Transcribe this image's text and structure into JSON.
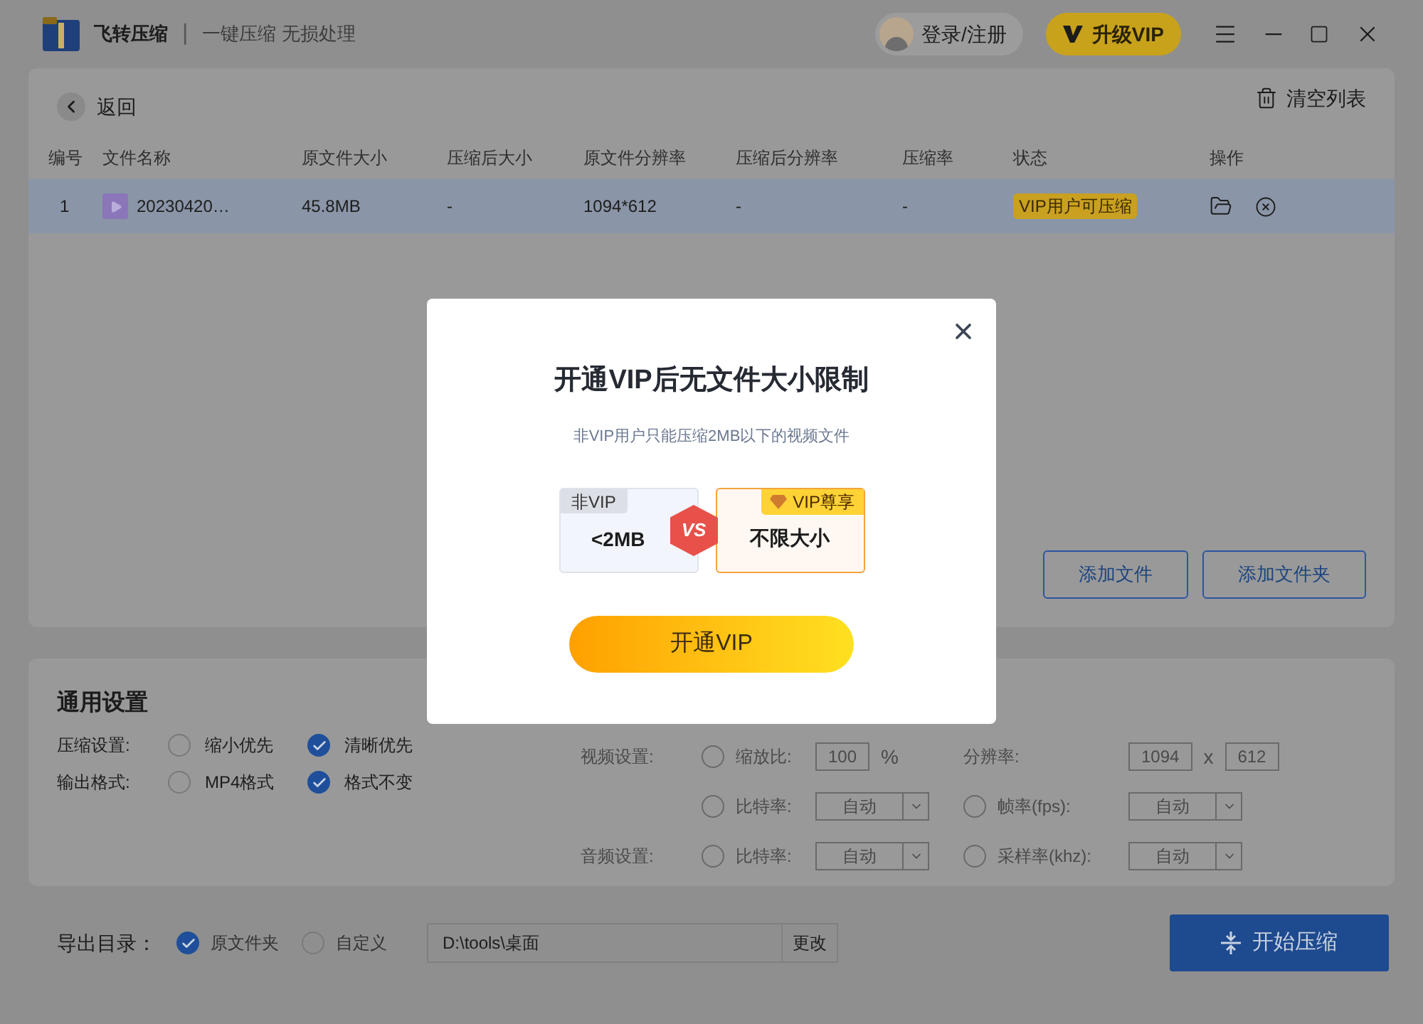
{
  "header": {
    "app_name": "飞转压缩",
    "separator": "|",
    "tagline": "一键压缩 无损处理",
    "login": "登录/注册",
    "upgrade": "升级VIP"
  },
  "toolbar": {
    "back": "返回",
    "clear": "清空列表"
  },
  "table": {
    "columns": [
      "编号",
      "文件名称",
      "原文件大小",
      "压缩后大小",
      "原文件分辨率",
      "压缩后分辨率",
      "压缩率",
      "状态",
      "操作"
    ],
    "rows": [
      {
        "selected": true,
        "cells": [
          "1",
          "20230420…",
          "45.8MB",
          "-",
          "1094*612",
          "-",
          "-"
        ],
        "status": "VIP用户可压缩"
      }
    ]
  },
  "file_buttons": [
    "添加文件",
    "添加文件夹"
  ],
  "settings": {
    "title": "通用设置",
    "rows": [
      {
        "label": "压缩设置:",
        "options": [
          {
            "label": "缩小优先",
            "checked": false
          },
          {
            "label": "清晰优先",
            "checked": true
          }
        ]
      },
      {
        "label": "输出格式:",
        "options": [
          {
            "label": "MP4格式",
            "checked": false
          },
          {
            "label": "格式不变",
            "checked": true
          }
        ]
      }
    ],
    "media_rows": [
      {
        "section": "视频设置:",
        "param1": {
          "label": "缩放比:",
          "kind": "radio",
          "checked": false
        },
        "control1": [
          {
            "kind": "input",
            "value": "100"
          },
          {
            "kind": "unit",
            "text": "%"
          }
        ],
        "param2": {
          "label": "分辨率:",
          "kind": "label"
        },
        "control2": [
          {
            "kind": "input",
            "value": "1094"
          },
          {
            "kind": "unit",
            "text": "x"
          },
          {
            "kind": "input",
            "value": "612"
          }
        ]
      },
      {
        "param1": {
          "label": "比特率:",
          "kind": "radio",
          "checked": false
        },
        "control1": [
          {
            "kind": "select",
            "value": "自动"
          }
        ],
        "param2": {
          "label": "帧率(fps):",
          "kind": "radio",
          "checked": false
        },
        "control2": [
          {
            "kind": "select",
            "value": "自动"
          }
        ]
      },
      {
        "section": "音频设置:",
        "param1": {
          "label": "比特率:",
          "kind": "radio",
          "checked": false
        },
        "control1": [
          {
            "kind": "select",
            "value": "自动"
          }
        ],
        "param2": {
          "label": "采样率(khz):",
          "kind": "radio",
          "checked": false
        },
        "control2": [
          {
            "kind": "select",
            "value": "自动"
          }
        ]
      }
    ]
  },
  "export": {
    "label": "导出目录：",
    "options": [
      {
        "label": "原文件夹",
        "checked": true
      },
      {
        "label": "自定义",
        "checked": false
      }
    ],
    "path": "D:\\tools\\桌面",
    "change": "更改",
    "start": "开始压缩"
  },
  "modal": {
    "title": "开通VIP后无文件大小限制",
    "subtitle": "非VIP用户只能压缩2MB以下的视频文件",
    "left": {
      "tag": "非VIP",
      "value": "<2MB"
    },
    "vs": "VS",
    "right": {
      "tag": "VIP尊享",
      "value": "不限大小"
    },
    "button": "开通VIP"
  }
}
